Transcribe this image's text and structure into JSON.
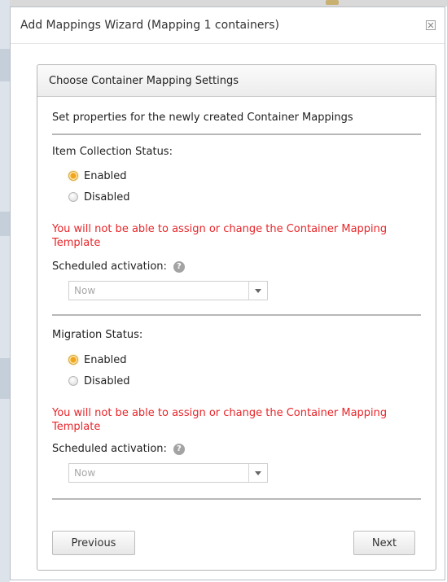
{
  "dialog": {
    "title": "Add Mappings Wizard (Mapping 1 containers)",
    "close_icon": "close-icon"
  },
  "panel": {
    "header": "Choose Container Mapping Settings",
    "description": "Set properties for the newly created Container Mappings"
  },
  "item_collection": {
    "label": "Item Collection Status:",
    "options": [
      {
        "label": "Enabled",
        "checked": true
      },
      {
        "label": "Disabled",
        "checked": false
      }
    ],
    "warning": "You will not be able to assign or change the Container Mapping Template",
    "scheduled_label": "Scheduled activation:",
    "scheduled_value": "Now"
  },
  "migration": {
    "label": "Migration Status:",
    "options": [
      {
        "label": "Enabled",
        "checked": true
      },
      {
        "label": "Disabled",
        "checked": false
      }
    ],
    "warning": "You will not be able to assign or change the Container Mapping Template",
    "scheduled_label": "Scheduled activation:",
    "scheduled_value": "Now"
  },
  "buttons": {
    "previous": "Previous",
    "next": "Next"
  },
  "colors": {
    "warning": "#e8262a",
    "radio_checked": "#f2a51c"
  }
}
